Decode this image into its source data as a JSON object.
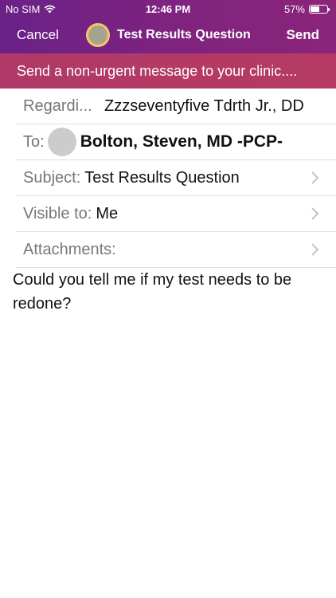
{
  "status_bar": {
    "carrier": "No SIM",
    "time": "12:46 PM",
    "battery_text": "57%",
    "battery_level": 0.57
  },
  "nav": {
    "cancel_label": "Cancel",
    "title": "Test Results Question",
    "send_label": "Send"
  },
  "banner": {
    "text": "Send a non-urgent message to your clinic...."
  },
  "form": {
    "regarding": {
      "label": "Regardi...",
      "value": "Zzzseventyfive Tdrth Jr., DD"
    },
    "to": {
      "label": "To:",
      "value": "Bolton, Steven, MD -PCP-"
    },
    "subject": {
      "label": "Subject:",
      "value": "Test Results Question"
    },
    "visible_to": {
      "label": "Visible to:",
      "value": "Me"
    },
    "attachments": {
      "label": "Attachments:"
    }
  },
  "message": {
    "body": "Could you tell me if my test needs to be redone?"
  },
  "colors": {
    "header": "#7a2282",
    "banner": "#b33a65",
    "avatar_ring": "#f2c66c"
  }
}
